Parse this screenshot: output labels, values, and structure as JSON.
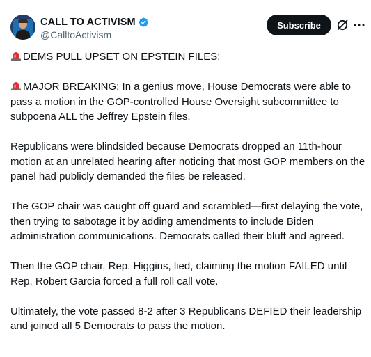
{
  "author": {
    "display_name": "CALL TO ACTIVISM",
    "handle": "@CalltoActivism",
    "verified": true,
    "avatar": "avatar-image"
  },
  "actions": {
    "subscribe_label": "Subscribe",
    "grok_icon": "grok-icon",
    "more_icon": "more-horizontal-icon"
  },
  "colors": {
    "text": "#0f1419",
    "secondary": "#536471",
    "verified_blue": "#1d9bf0",
    "button_bg": "#0f1419"
  },
  "tweet": {
    "headline_icon": "police-light-emoji",
    "headline": "DEMS PULL UPSET ON EPSTEIN FILES:",
    "breaking_icon": "police-light-emoji",
    "breaking": "MAJOR BREAKING: In a genius move, House Democrats were able to pass a motion in the GOP-controlled House Oversight subcommittee to subpoena ALL the Jeffrey Epstein files.",
    "p1": "Republicans were blindsided because Democrats dropped an 11th-hour motion at an unrelated hearing after noticing that most GOP members on the panel had publicly demanded the files be released.",
    "p2": "The GOP chair was caught off guard and scrambled—first delaying the vote, then trying to sabotage it by adding amendments to include Biden administration communications. Democrats called their bluff and agreed.",
    "p3": "Then the GOP chair, Rep. Higgins, lied, claiming the motion FAILED until Rep. Robert Garcia forced a full roll call vote.",
    "p4": "Ultimately, the vote passed 8-2 after 3 Republicans DEFIED their leadership and joined all 5 Democrats to pass the motion."
  }
}
